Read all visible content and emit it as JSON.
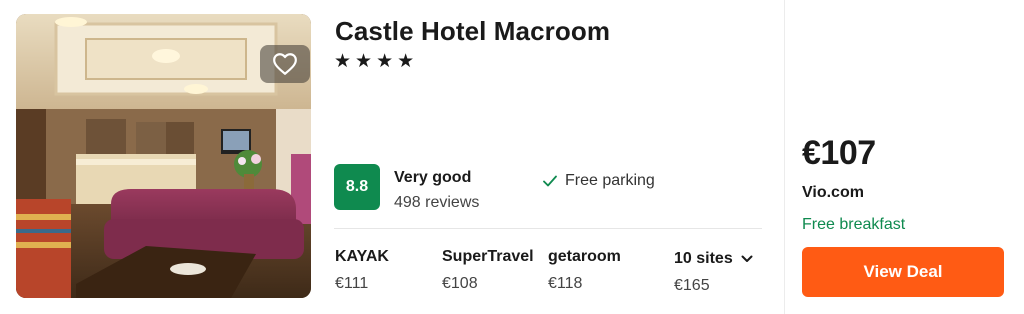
{
  "hotel": {
    "name": "Castle Hotel Macroom",
    "stars": "★★★★",
    "star_count": 4
  },
  "rating": {
    "score": "8.8",
    "label": "Very good",
    "reviews": "498 reviews",
    "color": "#0f8a4f"
  },
  "amenity": {
    "label": "Free parking",
    "icon": "check-icon"
  },
  "providers": [
    {
      "name": "KAYAK",
      "price": "€111"
    },
    {
      "name": "SuperTravel",
      "price": "€108"
    },
    {
      "name": "getaroom",
      "price": "€118"
    }
  ],
  "more_sites": {
    "label": "10 sites",
    "price": "€165",
    "icon": "chevron-down-icon"
  },
  "deal": {
    "price": "€107",
    "vendor": "Vio.com",
    "perk": "Free breakfast",
    "button_label": "View Deal",
    "button_color": "#ff5b14"
  },
  "favorite": {
    "icon": "heart-icon"
  }
}
